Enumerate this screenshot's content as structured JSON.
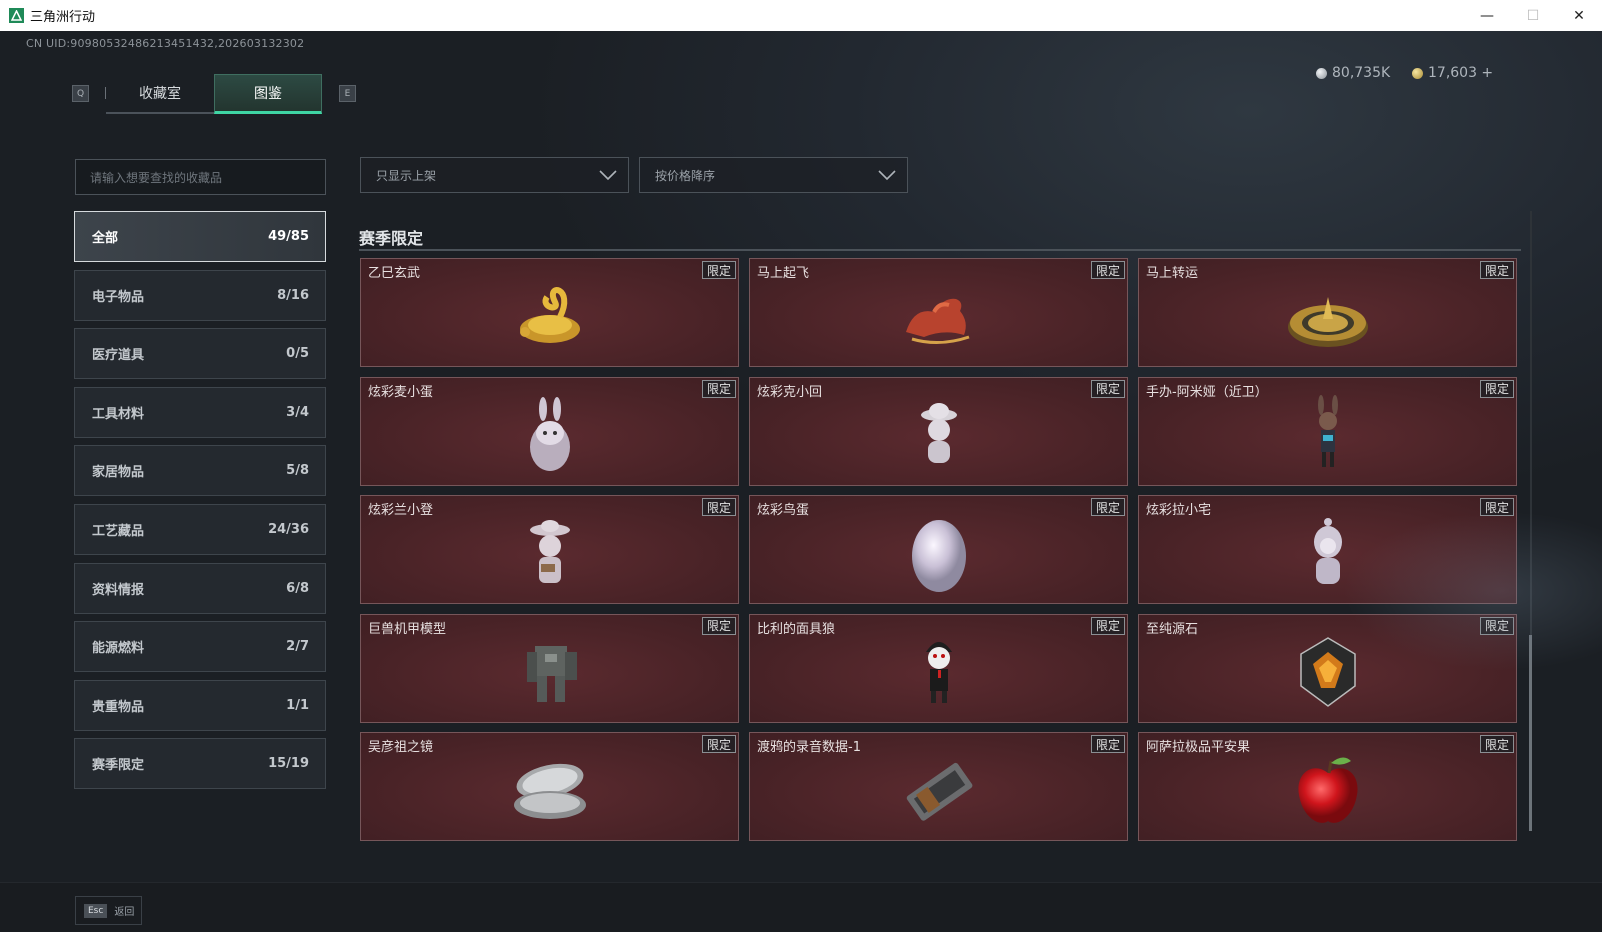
{
  "window": {
    "title": "三角洲行动",
    "minimize": "—",
    "maximize": "☐",
    "close": "✕"
  },
  "header": {
    "uid": "CN UID:9098053248621345143​2,202603132302",
    "key_left": "Q",
    "key_right": "E",
    "tabs": [
      {
        "label": "收藏室",
        "active": false
      },
      {
        "label": "图鉴",
        "active": true
      }
    ],
    "currency_silver": "80,735K",
    "currency_gold": "17,603 +"
  },
  "search": {
    "placeholder": "请输入想要查找的收藏品"
  },
  "filters": {
    "availability": "只显示上架",
    "sort": "按价格降序"
  },
  "categories": [
    {
      "label": "全部",
      "count": "49/85",
      "active": true
    },
    {
      "label": "电子物品",
      "count": "8/16"
    },
    {
      "label": "医疗道具",
      "count": "0/5"
    },
    {
      "label": "工具材料",
      "count": "3/4"
    },
    {
      "label": "家居物品",
      "count": "5/8"
    },
    {
      "label": "工艺藏品",
      "count": "24/36"
    },
    {
      "label": "资料情报",
      "count": "6/8"
    },
    {
      "label": "能源燃料",
      "count": "2/7"
    },
    {
      "label": "贵重物品",
      "count": "1/1"
    },
    {
      "label": "赛季限定",
      "count": "15/19"
    }
  ],
  "section": {
    "title": "赛季限定"
  },
  "items": [
    {
      "name": "乙巳玄武",
      "badge": "限定",
      "icon": "gold-serpent-tortoise-icon"
    },
    {
      "name": "马上起飞",
      "badge": "限定",
      "icon": "red-horse-icon"
    },
    {
      "name": "马上转运",
      "badge": "限定",
      "icon": "gold-compass-icon"
    },
    {
      "name": "炫彩麦小蛋",
      "badge": "限定",
      "icon": "rabbit-egg-figure-icon"
    },
    {
      "name": "炫彩克小回",
      "badge": "限定",
      "icon": "hat-figure-icon"
    },
    {
      "name": "手办-阿米娅（近卫）",
      "badge": "限定",
      "icon": "amiya-figure-icon"
    },
    {
      "name": "炫彩兰小登",
      "badge": "限定",
      "icon": "sombrero-figure-icon"
    },
    {
      "name": "炫彩鸟蛋",
      "badge": "限定",
      "icon": "pearl-egg-icon"
    },
    {
      "name": "炫彩拉小宅",
      "badge": "限定",
      "icon": "hooded-figure-icon"
    },
    {
      "name": "巨兽机甲模型",
      "badge": "限定",
      "icon": "mech-model-icon"
    },
    {
      "name": "比利的面具狼",
      "badge": "限定",
      "icon": "billy-puppet-icon"
    },
    {
      "name": "至纯源石",
      "badge": "限定",
      "icon": "originium-crystal-icon"
    },
    {
      "name": "吴彦祖之镜",
      "badge": "限定",
      "icon": "compact-mirror-icon"
    },
    {
      "name": "渡鸦的录音数据-1",
      "badge": "限定",
      "icon": "data-tape-icon"
    },
    {
      "name": "阿萨拉极品平安果",
      "badge": "限定",
      "icon": "red-apple-icon"
    }
  ],
  "footer": {
    "esc_key": "Esc",
    "esc_label": "返回"
  }
}
